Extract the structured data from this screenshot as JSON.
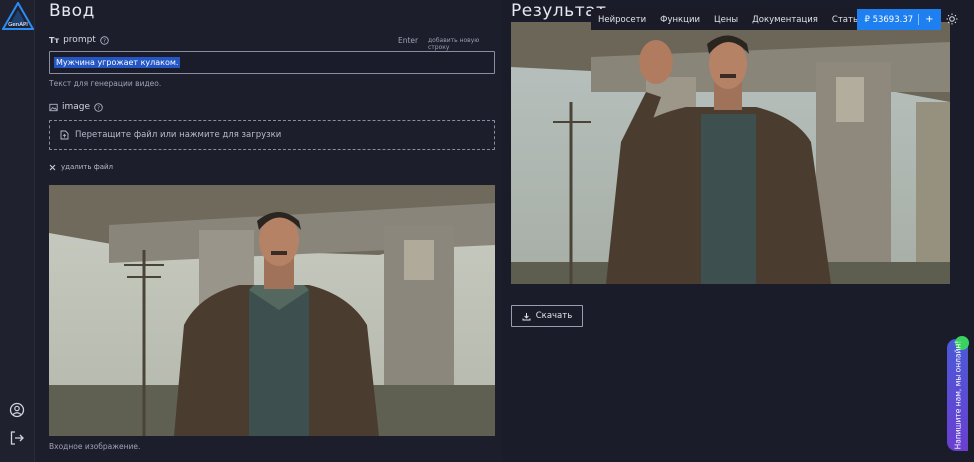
{
  "logo": {
    "text": "GenAPI"
  },
  "input_section": {
    "title": "Ввод",
    "prompt": {
      "label": "prompt",
      "label_icon": "text-type-icon",
      "help_icon": "help-circle-icon",
      "enter_label": "Enter",
      "enter_hint": "добавить новую строку",
      "value": "Мужчина угрожает кулаком.",
      "hint": "Текст для генерации видео."
    },
    "image": {
      "label": "image",
      "label_icon": "image-icon",
      "help_icon": "help-circle-icon",
      "dropzone_text": "Перетащите файл или нажмите для загрузки",
      "delete_label": "удалить файл",
      "caption": "Входное изображение."
    }
  },
  "result_section": {
    "title": "Результат",
    "download_label": "Скачать"
  },
  "nav": {
    "items": [
      "Нейросети",
      "Функции",
      "Цены",
      "Документация",
      "Статьи"
    ],
    "balance": "₽ 53693.37",
    "balance_add": "+"
  },
  "chat": {
    "label": "Напишите нам, мы онлайн!"
  },
  "colors": {
    "accent": "#1e7ff0",
    "background": "#1e1f2e",
    "chat": "#5a4ad8",
    "online": "#3ad062"
  }
}
